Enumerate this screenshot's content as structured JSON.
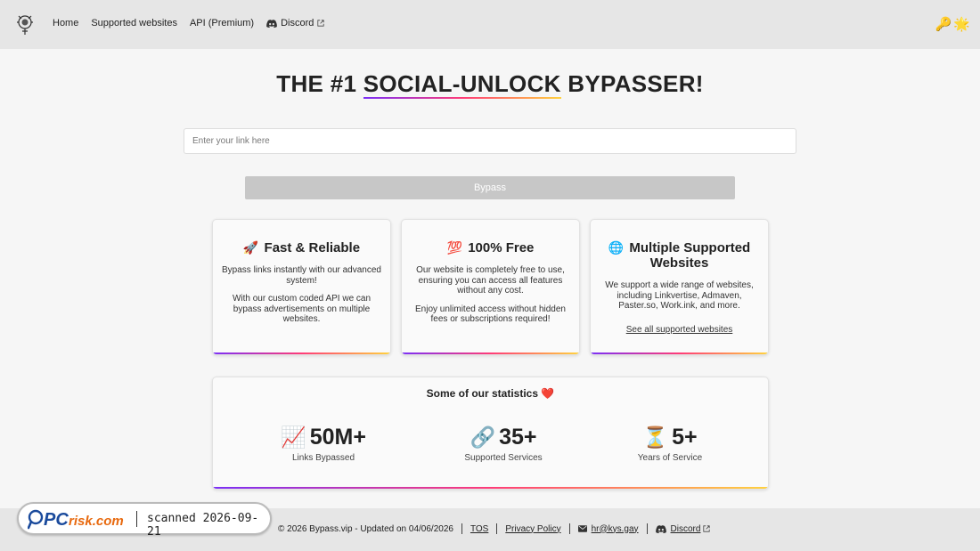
{
  "header": {
    "nav": [
      {
        "label": "Home"
      },
      {
        "label": "Supported websites"
      },
      {
        "label": "API (Premium)"
      },
      {
        "label": "Discord"
      }
    ],
    "right_icons": [
      "🔑",
      "🌟"
    ]
  },
  "hero": {
    "title_prefix": "THE #1 ",
    "title_highlight": "SOCIAL-UNLOCK",
    "title_suffix": " BYPASSER!",
    "input_placeholder": "Enter your link here",
    "input_value": "",
    "button_label": "Bypass"
  },
  "cards": [
    {
      "emoji": "🚀",
      "title": "Fast & Reliable",
      "p1": "Bypass links instantly with our advanced system!",
      "p2": "With our custom coded API we can bypass advertisements on multiple websites."
    },
    {
      "emoji": "💯",
      "title": "100% Free",
      "p1": "Our website is completely free to use, ensuring you can access all features without any cost.",
      "p2": "Enjoy unlimited access without hidden fees or subscriptions required!"
    },
    {
      "emoji": "🌐",
      "title": "Multiple Supported Websites",
      "p1": "We support a wide range of websites, including Linkvertise, Admaven, Paster.so, Work.ink, and more.",
      "link": "See all supported websites"
    }
  ],
  "stats": {
    "title": "Some of our statistics ❤️",
    "items": [
      {
        "emoji": "📈",
        "value": "50M+",
        "label": "Links Bypassed"
      },
      {
        "emoji": "🔗",
        "value": "35+",
        "label": "Supported Services"
      },
      {
        "emoji": "⏳",
        "value": "5+",
        "label": "Years of Service"
      }
    ]
  },
  "footer": {
    "copyright": "© 2026 Bypass.vip - Updated on 04/06/2026",
    "tos": "TOS",
    "privacy": "Privacy Policy",
    "email": "hr@kys.gay",
    "discord": "Discord"
  },
  "watermark": {
    "brand": "PCrisk.com",
    "text": "scanned 2026-09-21"
  },
  "colors": {
    "accent_gradient": [
      "#7b2ff7",
      "#ff3c78",
      "#ffd23f"
    ],
    "button_bg": "#c7c7c7",
    "header_bg": "#e6e6e6"
  }
}
